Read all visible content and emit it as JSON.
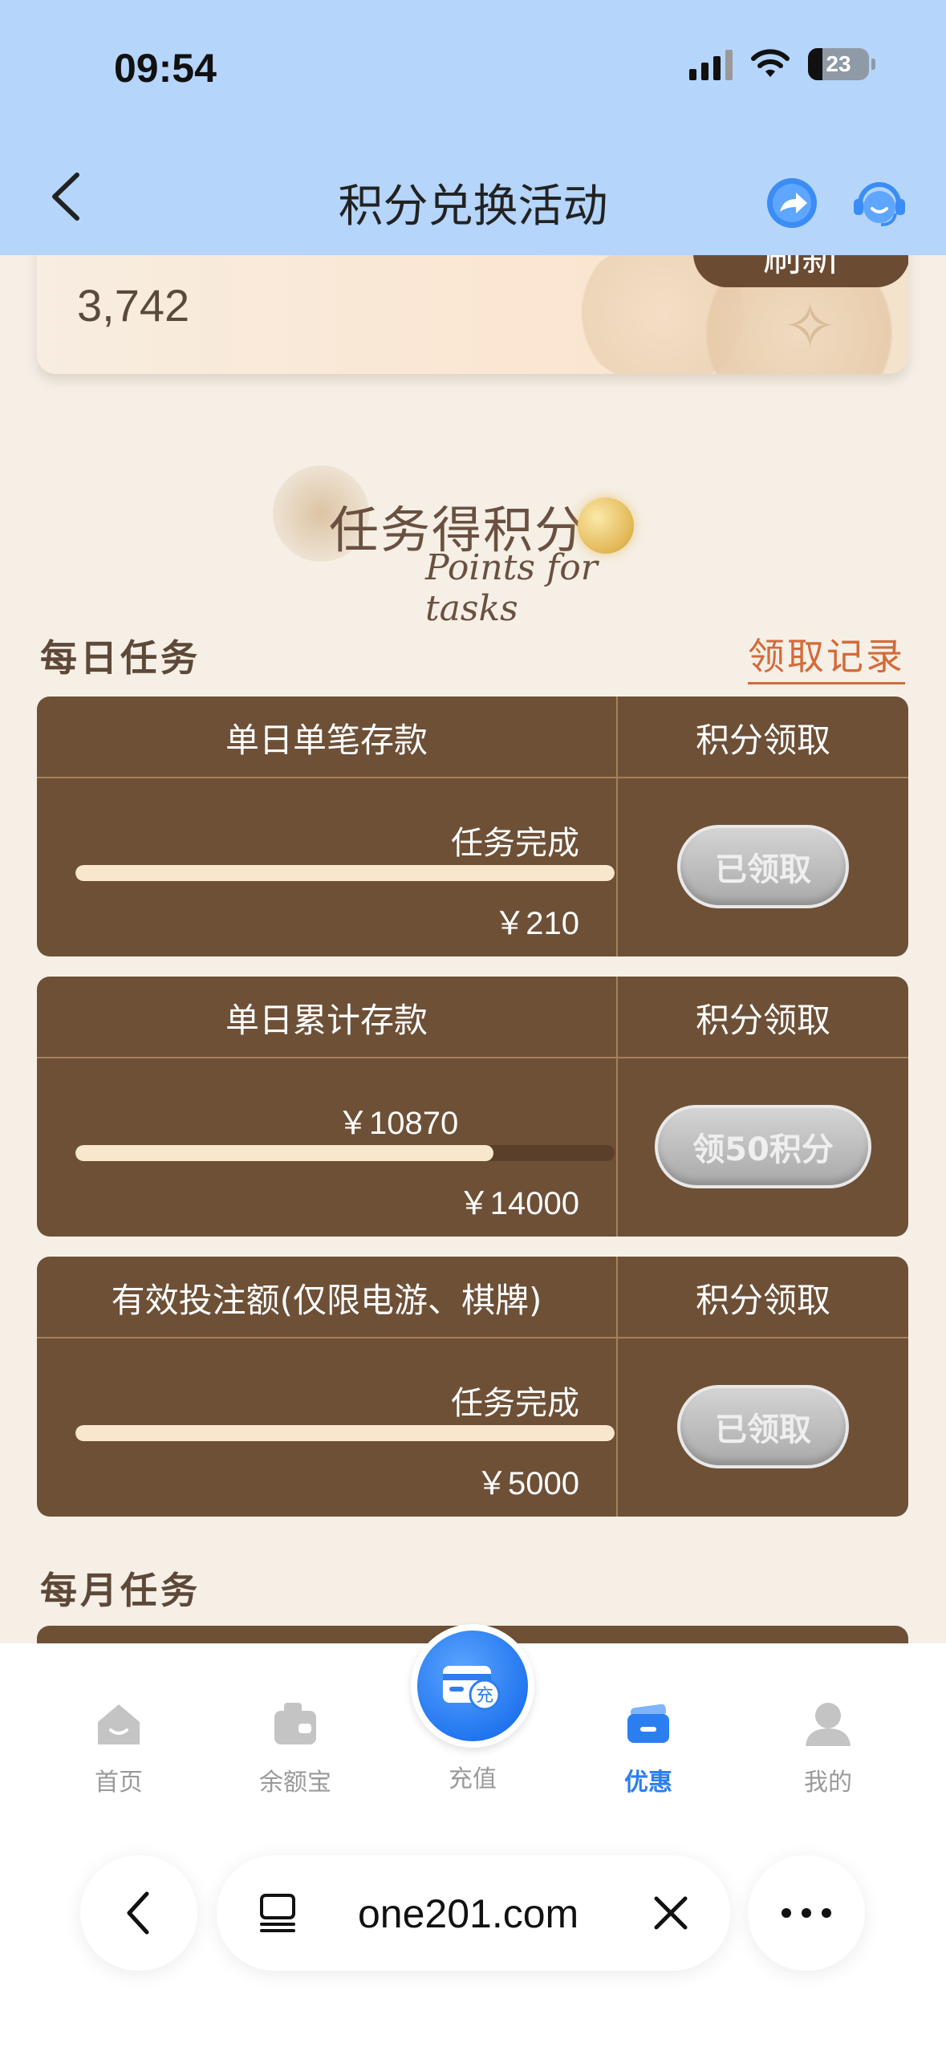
{
  "status_bar": {
    "time": "09:54",
    "battery": "23"
  },
  "header": {
    "title": "积分兑换活动"
  },
  "points_card": {
    "value": "3,742",
    "refresh_label": "刷新"
  },
  "task_banner": {
    "title": "任务得积分",
    "subtitle": "Points for tasks"
  },
  "daily": {
    "label": "每日任务",
    "history_link": "领取记录",
    "tasks": [
      {
        "name": "单日单笔存款",
        "col_header": "积分领取",
        "top_text": "任务完成",
        "progress": 1.0,
        "bottom_text": "￥210",
        "button": "已领取"
      },
      {
        "name": "单日累计存款",
        "col_header": "积分领取",
        "top_text": "￥10870",
        "progress": 0.776,
        "bottom_text": "￥14000",
        "button": "领50积分"
      },
      {
        "name": "有效投注额(仅限电游、棋牌)",
        "col_header": "积分领取",
        "top_text": "任务完成",
        "progress": 1.0,
        "bottom_text": "￥5000",
        "button": "已领取"
      }
    ]
  },
  "monthly": {
    "label": "每月任务"
  },
  "tabbar": {
    "items": [
      {
        "label": "首页",
        "icon": "home-icon"
      },
      {
        "label": "余额宝",
        "icon": "wallet-icon"
      },
      {
        "label": "充值",
        "icon": "recharge-card-icon",
        "badge": "充"
      },
      {
        "label": "优惠",
        "icon": "promo-icon"
      },
      {
        "label": "我的",
        "icon": "user-icon"
      }
    ],
    "active": "优惠",
    "active_color": "#2b7ef0"
  },
  "browser": {
    "url": "one201.com"
  }
}
